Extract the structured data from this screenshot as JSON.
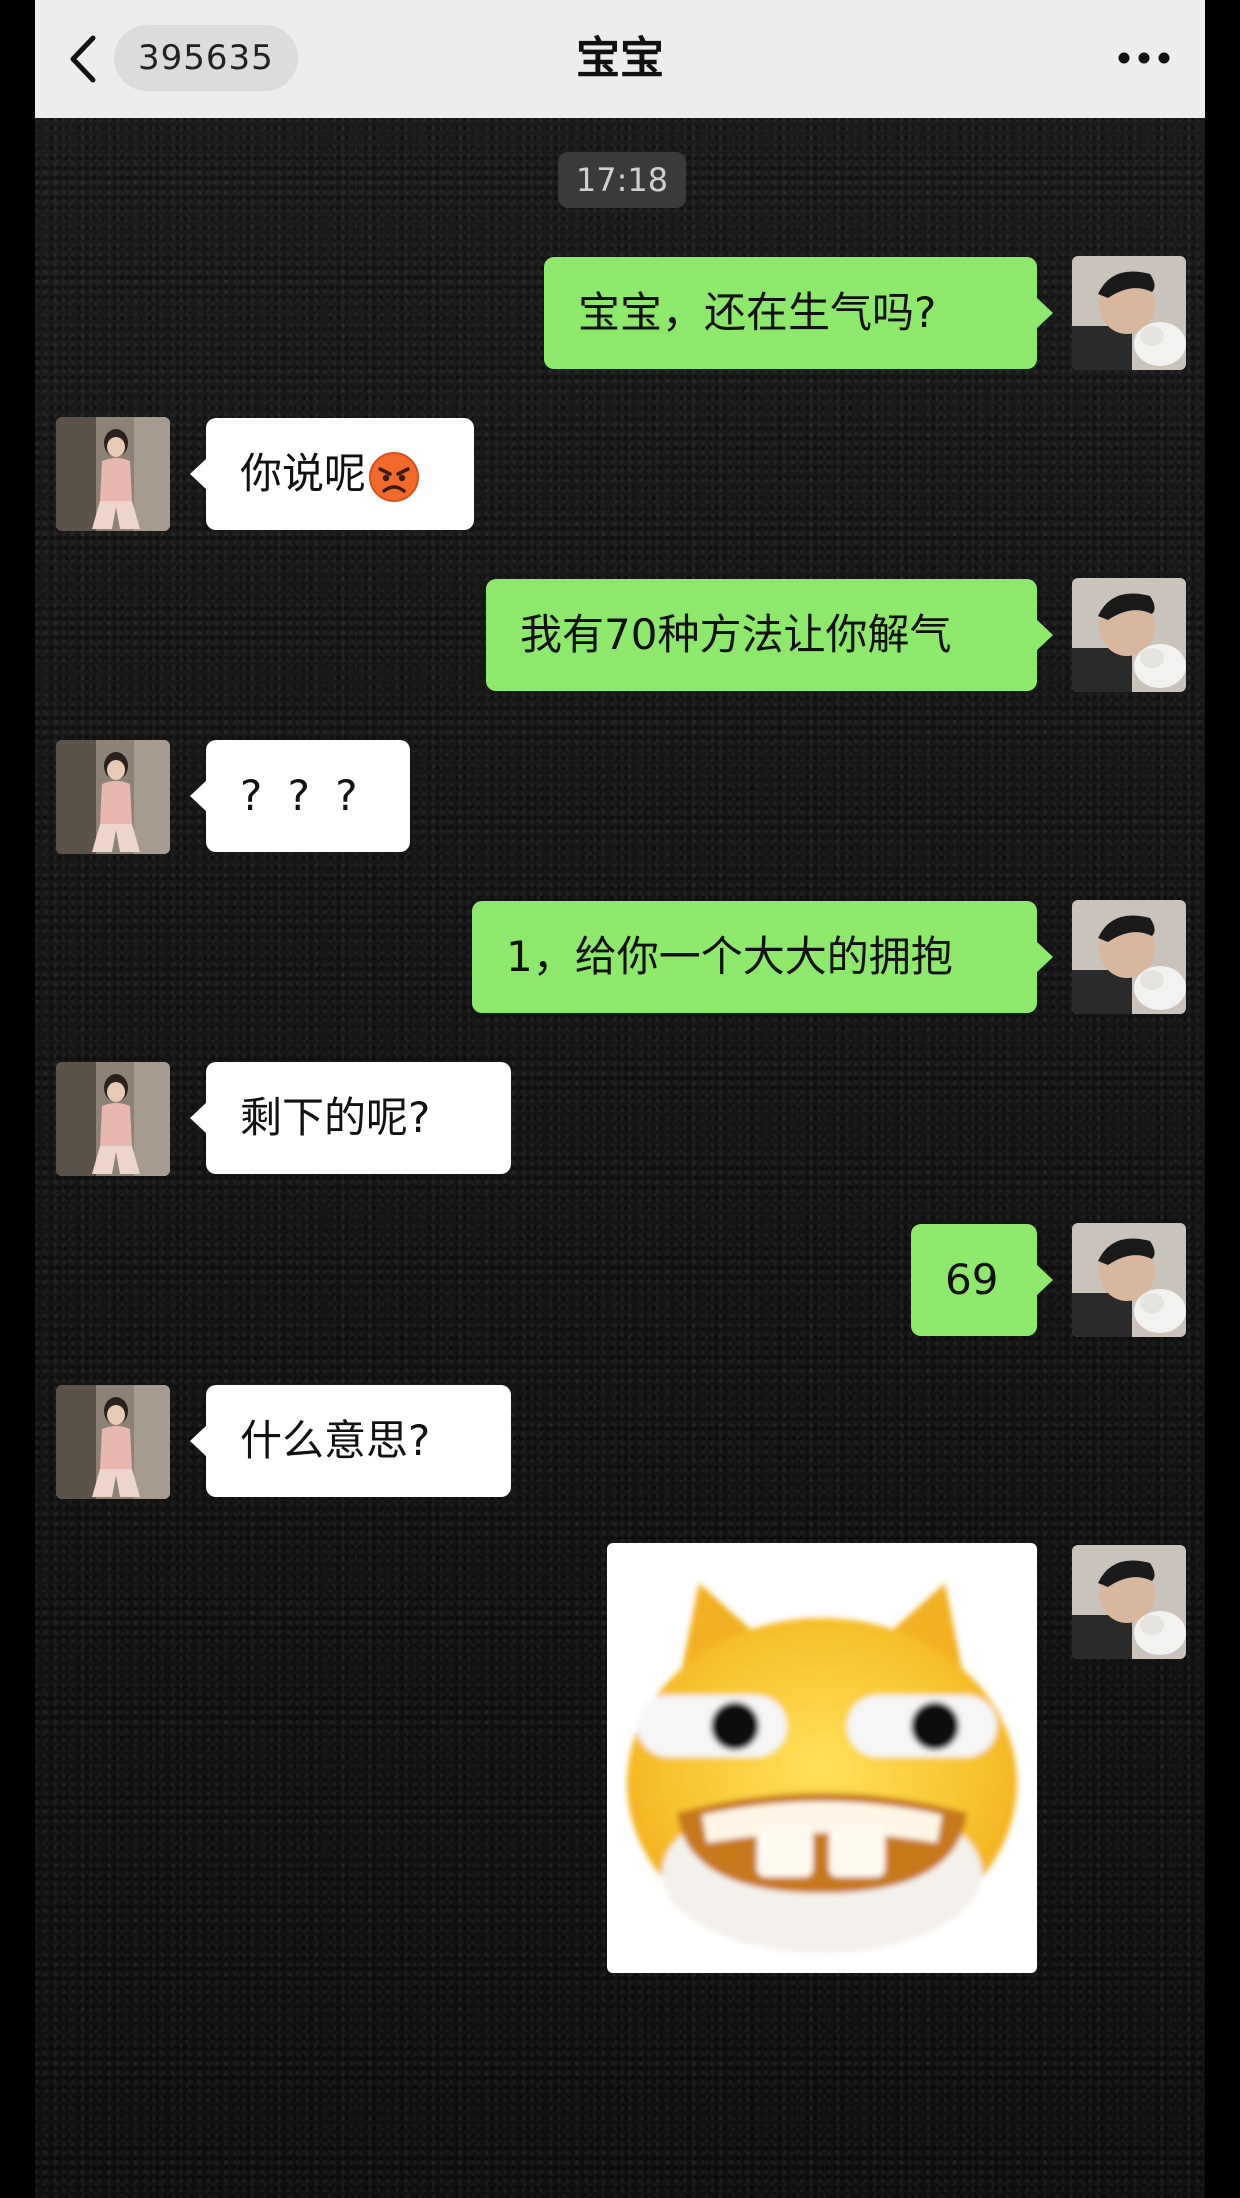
{
  "header": {
    "unread_count": "395635",
    "title": "宝宝"
  },
  "timestamp": "17:18",
  "messages": [
    {
      "side": "me",
      "text": "宝宝，还在生气吗?"
    },
    {
      "side": "them",
      "text": "你说呢",
      "emoji": "angry-face-emoji"
    },
    {
      "side": "me",
      "text": "我有70种方法让你解气"
    },
    {
      "side": "them",
      "text": "? ? ?"
    },
    {
      "side": "me",
      "text": "1，给你一个大大的拥抱"
    },
    {
      "side": "them",
      "text": "剩下的呢?"
    },
    {
      "side": "me",
      "text": "69"
    },
    {
      "side": "them",
      "text": "什么意思?"
    },
    {
      "side": "me",
      "type": "sticker",
      "sticker": "grinning-yellow-cat-sticker"
    }
  ],
  "colors": {
    "my_bubble": "#8ee86b",
    "their_bubble": "#ffffff",
    "header_bg": "#ededed",
    "chat_bg": "#161616"
  }
}
